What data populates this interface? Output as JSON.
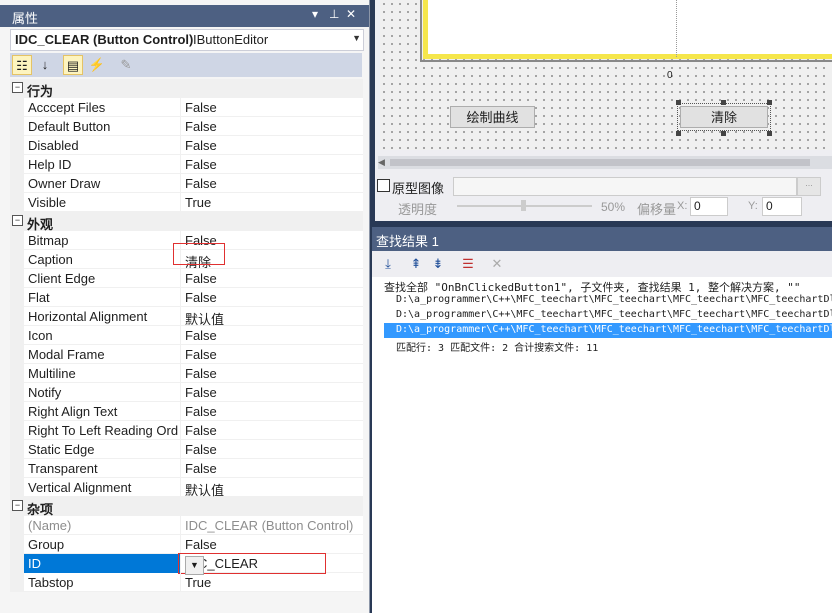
{
  "properties": {
    "title": "属性",
    "object_name": "IDC_CLEAR (Button Control)",
    "object_type": "IButtonEditor",
    "categories": [
      {
        "label": "行为",
        "rows": [
          {
            "name": "Acccept Files",
            "value": "False"
          },
          {
            "name": "Default Button",
            "value": "False"
          },
          {
            "name": "Disabled",
            "value": "False"
          },
          {
            "name": "Help ID",
            "value": "False"
          },
          {
            "name": "Owner Draw",
            "value": "False"
          },
          {
            "name": "Visible",
            "value": "True"
          }
        ]
      },
      {
        "label": "外观",
        "rows": [
          {
            "name": "Bitmap",
            "value": "False"
          },
          {
            "name": "Caption",
            "value": "清除"
          },
          {
            "name": "Client Edge",
            "value": "False"
          },
          {
            "name": "Flat",
            "value": "False"
          },
          {
            "name": "Horizontal Alignment",
            "value": "默认值"
          },
          {
            "name": "Icon",
            "value": "False"
          },
          {
            "name": "Modal Frame",
            "value": "False"
          },
          {
            "name": "Multiline",
            "value": "False"
          },
          {
            "name": "Notify",
            "value": "False"
          },
          {
            "name": "Right Align Text",
            "value": "False"
          },
          {
            "name": "Right To Left Reading Ord",
            "value": "False"
          },
          {
            "name": "Static Edge",
            "value": "False"
          },
          {
            "name": "Transparent",
            "value": "False"
          },
          {
            "name": "Vertical Alignment",
            "value": "默认值"
          }
        ]
      },
      {
        "label": "杂项",
        "rows": [
          {
            "name": "(Name)",
            "value": "IDC_CLEAR (Button Control)"
          },
          {
            "name": "Group",
            "value": "False"
          },
          {
            "name": "ID",
            "value": "IDC_CLEAR"
          },
          {
            "name": "Tabstop",
            "value": "True"
          }
        ]
      }
    ]
  },
  "editor": {
    "axis_label": "0",
    "draw_button": "绘制曲线",
    "clear_button": "清除",
    "original_image_label": "原型图像",
    "transparency_label": "透明度",
    "transparency_value": "50%",
    "offset_label": "偏移量",
    "x_label": "X:",
    "x_value": "0",
    "y_label": "Y:",
    "y_value": "0"
  },
  "find_results": {
    "title": "查找结果 1",
    "lines": [
      "查找全部 \"OnBnClickedButton1\", 子文件夹, 查找结果 1, 整个解决方案, \"\"",
      "D:\\a_programmer\\C++\\MFC_teechart\\MFC_teechart\\MFC_teechart\\MFC_teechartDl",
      "D:\\a_programmer\\C++\\MFC_teechart\\MFC_teechart\\MFC_teechart\\MFC_teechartDl",
      "D:\\a_programmer\\C++\\MFC_teechart\\MFC_teechart\\MFC_teechart\\MFC_teechartDl",
      "匹配行: 3    匹配文件: 2    合计搜索文件: 11"
    ]
  }
}
